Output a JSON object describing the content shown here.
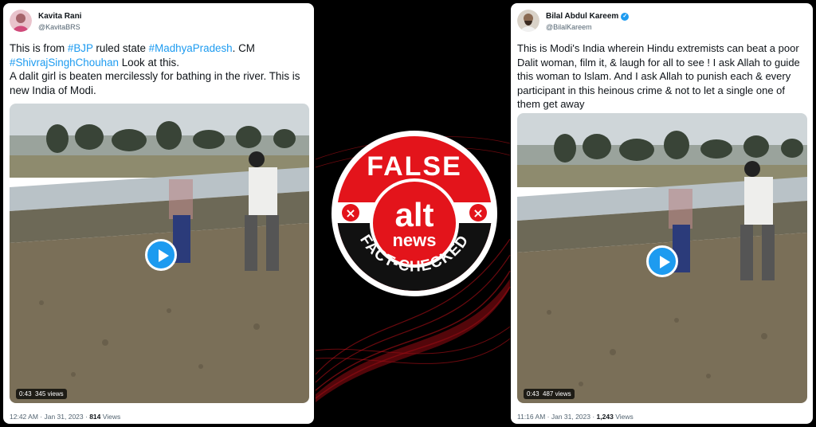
{
  "left_tweet": {
    "author_name": "Kavita Rani",
    "author_handle": "@KavitaBRS",
    "text_parts": [
      {
        "t": "This is from ",
        "tag": false
      },
      {
        "t": "#BJP",
        "tag": true
      },
      {
        "t": " ruled state ",
        "tag": false
      },
      {
        "t": "#MadhyaPradesh",
        "tag": true
      },
      {
        "t": ". CM ",
        "tag": false
      },
      {
        "t": "#ShivrajSinghChouhan",
        "tag": true
      },
      {
        "t": " Look at this.",
        "tag": false
      }
    ],
    "text_line2": "A dalit girl is beaten mercilessly for bathing in the river. This is new India of Modi.",
    "video_time": "0:43",
    "video_views": "345 views",
    "timestamp": "12:42 AM · Jan 31, 2023 · ",
    "views_count": "814",
    "views_label": " Views"
  },
  "right_tweet": {
    "author_name": "Bilal Abdul Kareem",
    "author_handle": "@BilalKareem",
    "verified_glyph": "✓",
    "text": "This is Modi's India wherein Hindu extremists can beat a poor Dalit woman, film it, & laugh for all to see ! I ask Allah to guide this woman to Islam. And I ask Allah to punish each & every participant in this heinous crime & not to let a single one of them get away",
    "video_time": "0:43",
    "video_views": "487 views",
    "timestamp": "11:16 AM · Jan 31, 2023 · ",
    "views_count": "1,243",
    "views_label": " Views"
  },
  "badge": {
    "verdict": "FALSE",
    "brand_top": "alt",
    "brand_bottom": "news",
    "ribbon": "FACT-CHECKED",
    "mark_glyph": "×"
  },
  "colors": {
    "brand_red": "#e3141b",
    "link_blue": "#1d9bf0"
  }
}
